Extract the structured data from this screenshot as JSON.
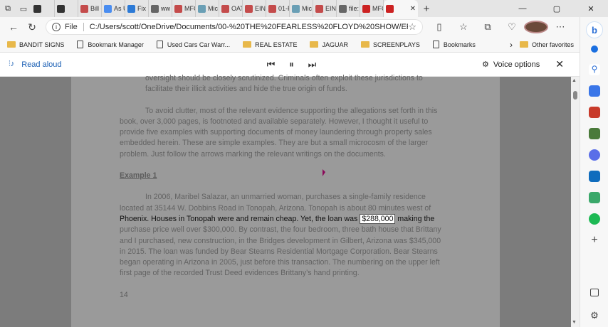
{
  "tabs": [
    {
      "label": "",
      "color": "#333333"
    },
    {
      "label": "",
      "color": "#333333"
    },
    {
      "label": "Bill c",
      "color": "#c44b4b"
    },
    {
      "label": "As U",
      "color": "#4a8df0"
    },
    {
      "label": "Fix n",
      "color": "#2c7ad6"
    },
    {
      "label": "ww",
      "color": "#666666"
    },
    {
      "label": "MFC",
      "color": "#c44b4b"
    },
    {
      "label": "Mic",
      "color": "#6a9fb5"
    },
    {
      "label": "OAT",
      "color": "#c44b4b"
    },
    {
      "label": "EIN",
      "color": "#c44b4b"
    },
    {
      "label": "01-F",
      "color": "#c44b4b"
    },
    {
      "label": "Mic",
      "color": "#6a9fb5"
    },
    {
      "label": "EIN",
      "color": "#c44b4b"
    },
    {
      "label": "file:",
      "color": "#666666"
    },
    {
      "label": "MFC",
      "color": "#cc2222"
    }
  ],
  "active_tab": {
    "label": "",
    "close": "✕",
    "color": "#cc2222"
  },
  "new_tab": "+",
  "window_controls": [
    "—",
    "▢",
    "✕"
  ],
  "address_bar": {
    "scheme_label": "File",
    "url": "C:/Users/scott/OneDrive/Documents/00-%20THE%20FEARLESS%20FLOYD%20SHOW/EPISOD..."
  },
  "favorites": [
    {
      "label": "BANDIT SIGNS",
      "type": "folder"
    },
    {
      "label": "Bookmark Manager",
      "type": "page"
    },
    {
      "label": "Used Cars Car Warr...",
      "type": "page"
    },
    {
      "label": "REAL ESTATE",
      "type": "folder"
    },
    {
      "label": "JAGUAR",
      "type": "folder"
    },
    {
      "label": "SCREENPLAYS",
      "type": "folder"
    },
    {
      "label": "Bookmarks",
      "type": "page"
    }
  ],
  "other_favorites": "Other favorites",
  "read_aloud": {
    "title": "Read aloud",
    "voice_options": "Voice options"
  },
  "document": {
    "para0": "oversight should be closely scrutinized. Criminals often exploit these jurisdictions to facilitate their illicit activities and hide the true origin of funds.",
    "para1": "To avoid clutter, most of the relevant evidence supporting the allegations set forth in this book, over 3,000 pages, is footnoted and available separately. However, I thought it useful to provide five examples with supporting documents of money laundering through property sales embedded herein. These are simple examples. They are but a small microcosm of the larger problem. Just follow the arrows marking the relevant writings on the documents.",
    "example_heading": "Example 1",
    "para2_before": "In 2006, Maribel Salazar, an unmarried woman, purchases a single-family residence located at 35144 W. Dobbins Road in Tonopah, Arizona. Tonopah is about 80 minutes west of",
    "highlight_before": "Phoenix.  Houses in Tonopah were and remain cheap.  Yet, the loan was",
    "highlight_word": "$288,000",
    "highlight_after": "making the",
    "para2_after": "purchase price well over $300,000. By contrast, the four bedroom, three bath house that Brittany and I purchased, new construction, in the Bridges development in Gilbert, Arizona was $345,000 in 2015. The loan was funded by Bear Stearns Residential Mortgage Corporation. Bear Stearns began operating in Arizona in 2005, just before this transaction. The numbering on the upper left first page of the recorded Trust Deed evidences Brittany’s hand printing.",
    "page_number": "14"
  }
}
